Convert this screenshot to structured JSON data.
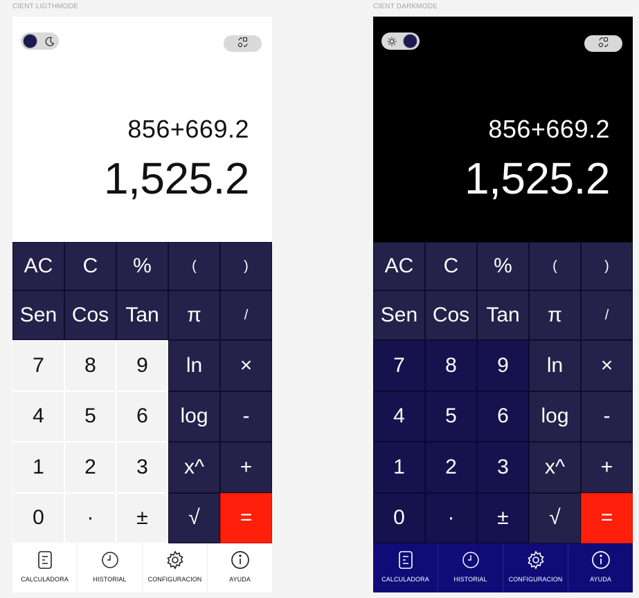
{
  "frames": {
    "light": {
      "label": "CIENT LIGTHMODE",
      "theme_toggle_icon": "moon-icon",
      "rotate_icon": "rotate-icon",
      "expression": "856+669.2",
      "result": "1,525.2"
    },
    "dark": {
      "label": "CIENT DARKMODE",
      "theme_toggle_icon": "sun-icon",
      "rotate_icon": "rotate-icon",
      "expression": "856+669.2",
      "result": "1,525.2"
    }
  },
  "keys": [
    {
      "label": "AC",
      "name": "clear-all-key"
    },
    {
      "label": "C",
      "name": "clear-key"
    },
    {
      "label": "%",
      "name": "percent-key"
    },
    {
      "label": "(",
      "name": "open-paren-key"
    },
    {
      "label": ")",
      "name": "close-paren-key"
    },
    {
      "label": "Sen",
      "name": "sin-key"
    },
    {
      "label": "Cos",
      "name": "cos-key"
    },
    {
      "label": "Tan",
      "name": "tan-key"
    },
    {
      "label": "π",
      "name": "pi-key"
    },
    {
      "label": "/",
      "name": "divide-key"
    },
    {
      "label": "7",
      "name": "digit-7-key"
    },
    {
      "label": "8",
      "name": "digit-8-key"
    },
    {
      "label": "9",
      "name": "digit-9-key"
    },
    {
      "label": "ln",
      "name": "ln-key"
    },
    {
      "label": "×",
      "name": "multiply-key"
    },
    {
      "label": "4",
      "name": "digit-4-key"
    },
    {
      "label": "5",
      "name": "digit-5-key"
    },
    {
      "label": "6",
      "name": "digit-6-key"
    },
    {
      "label": "log",
      "name": "log-key"
    },
    {
      "label": "-",
      "name": "minus-key"
    },
    {
      "label": "1",
      "name": "digit-1-key"
    },
    {
      "label": "2",
      "name": "digit-2-key"
    },
    {
      "label": "3",
      "name": "digit-3-key"
    },
    {
      "label": "x^",
      "name": "power-key"
    },
    {
      "label": "+",
      "name": "plus-key"
    },
    {
      "label": "0",
      "name": "digit-0-key"
    },
    {
      "label": "·",
      "name": "decimal-key"
    },
    {
      "label": "±",
      "name": "sign-key"
    },
    {
      "label": "√",
      "name": "sqrt-key"
    },
    {
      "label": "=",
      "name": "equals-key"
    }
  ],
  "nav": [
    {
      "label": "CALCULADORA",
      "icon": "calculator-icon"
    },
    {
      "label": "HISTORIAL",
      "icon": "clock-icon"
    },
    {
      "label": "CONFIGURACION",
      "icon": "gear-icon"
    },
    {
      "label": "AYUDA",
      "icon": "info-icon"
    }
  ],
  "colors": {
    "function_key": "#24224a",
    "light_number_key": "#f3f3f3",
    "dark_number_key": "#15124e",
    "equals_key": "#ff1f0a",
    "dark_nav": "#0f0c78"
  }
}
